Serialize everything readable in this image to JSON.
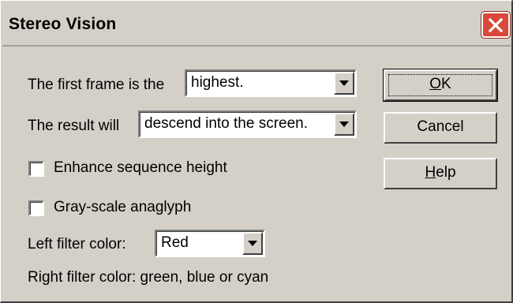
{
  "window": {
    "title": "Stereo Vision",
    "close_icon": "close-icon"
  },
  "form": {
    "first_frame_label": "The first frame is the",
    "first_frame_value": "highest.",
    "result_label": "The result will",
    "result_value": "descend into the screen.",
    "enhance_label": "Enhance sequence height",
    "enhance_checked": false,
    "grayscale_label": "Gray-scale anaglyph",
    "grayscale_checked": false,
    "left_filter_label": "Left filter color:",
    "left_filter_value": "Red",
    "right_filter_text": "Right filter color:  green, blue or cyan"
  },
  "buttons": {
    "ok_mnemonic": "O",
    "ok_rest": "K",
    "cancel": "Cancel",
    "help_mnemonic": "H",
    "help_rest": "elp"
  }
}
